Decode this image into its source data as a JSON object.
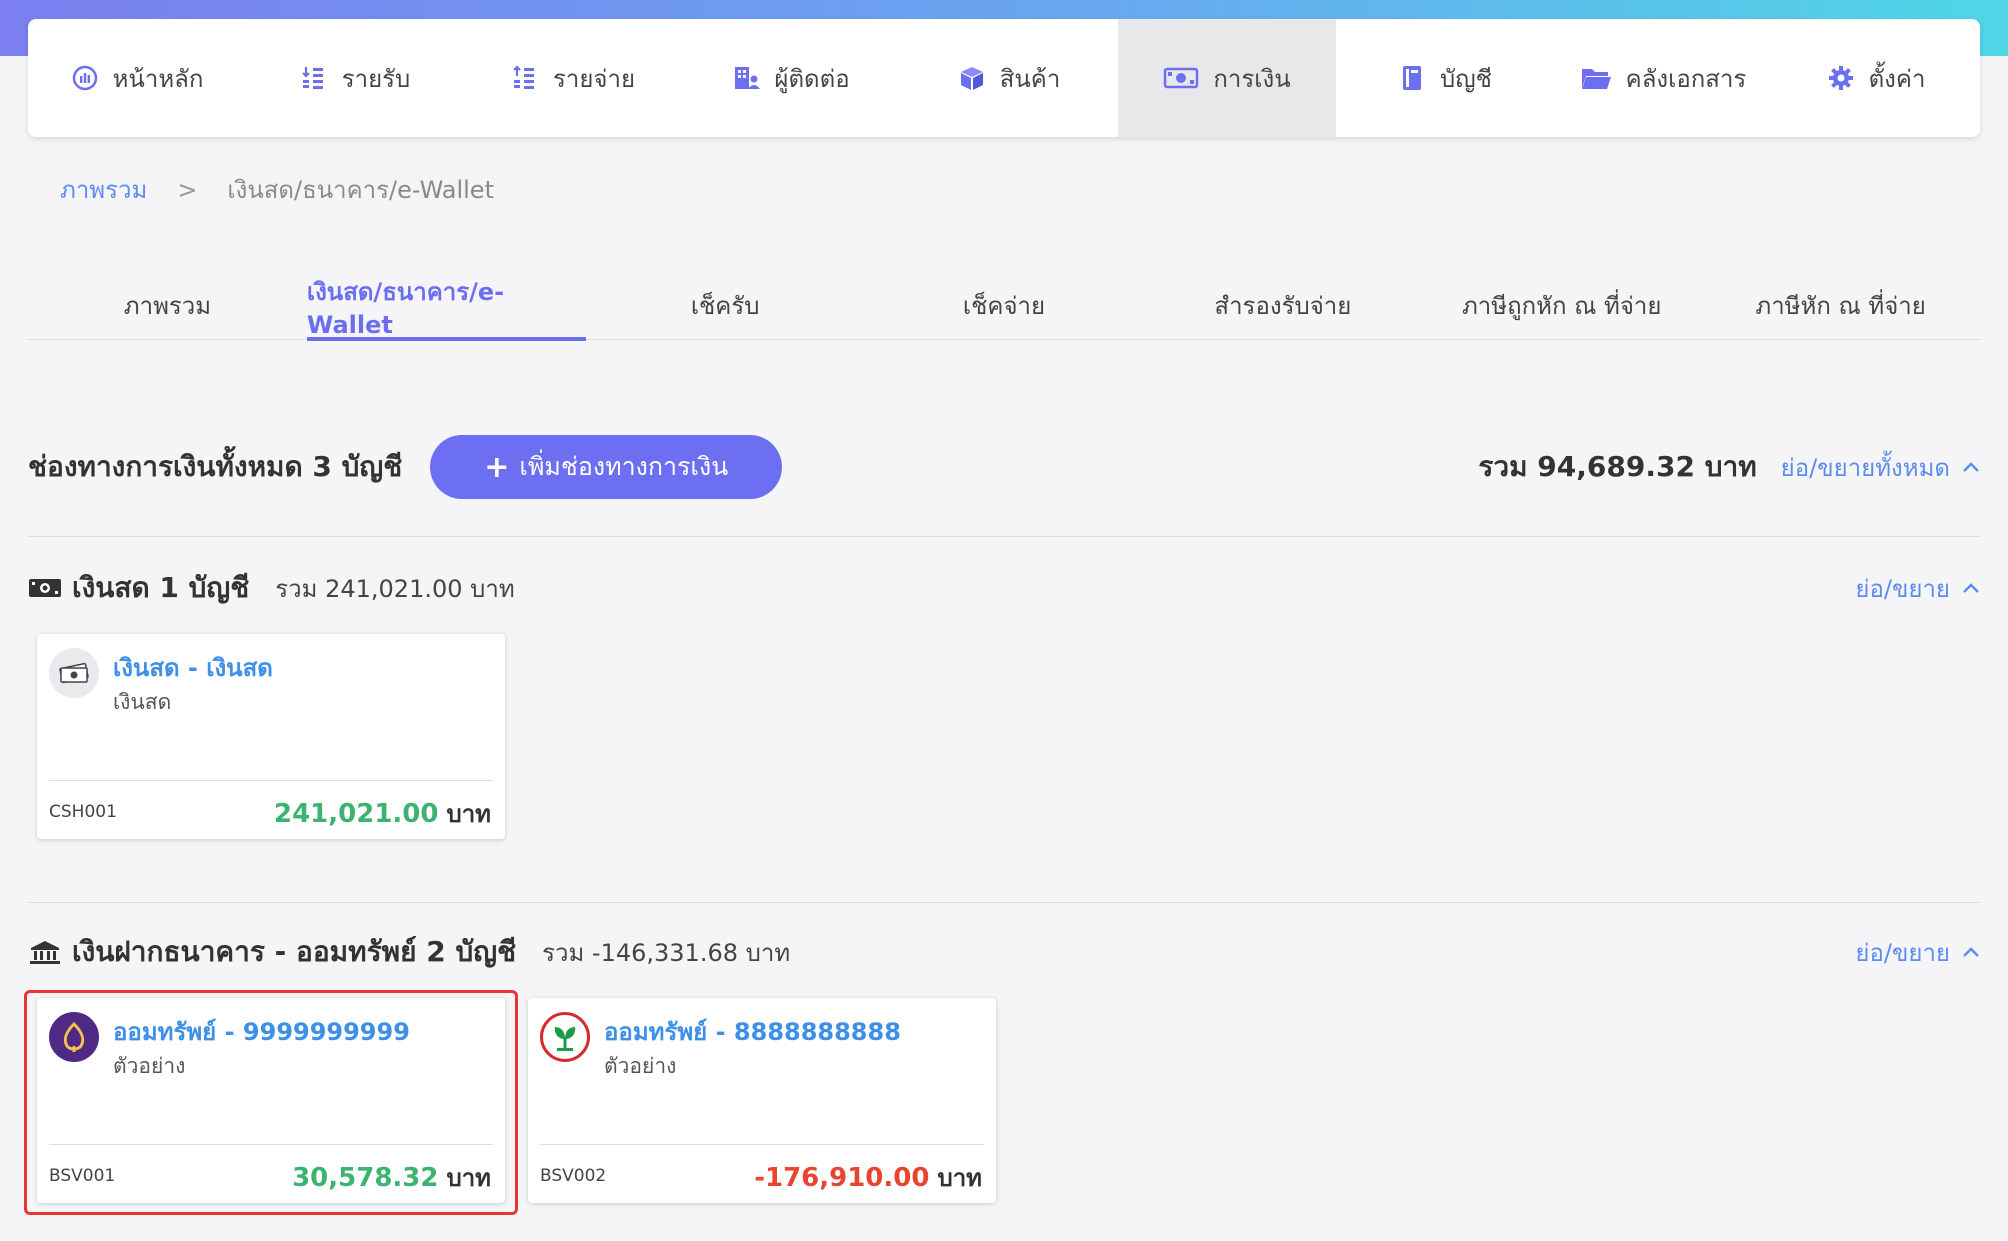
{
  "nav": {
    "items": [
      {
        "label": "หน้าหลัก",
        "icon": "dashboard-icon",
        "active": false
      },
      {
        "label": "รายรับ",
        "icon": "income-list-icon",
        "active": false
      },
      {
        "label": "รายจ่าย",
        "icon": "expense-list-icon",
        "active": false
      },
      {
        "label": "ผู้ติดต่อ",
        "icon": "contacts-building-icon",
        "active": false
      },
      {
        "label": "สินค้า",
        "icon": "product-box-icon",
        "active": false
      },
      {
        "label": "การเงิน",
        "icon": "money-icon",
        "active": true
      },
      {
        "label": "บัญชี",
        "icon": "ledger-book-icon",
        "active": false
      },
      {
        "label": "คลังเอกสาร",
        "icon": "folder-icon",
        "active": false
      },
      {
        "label": "ตั้งค่า",
        "icon": "gear-icon",
        "active": false
      }
    ]
  },
  "breadcrumb": {
    "root": "ภาพรวม",
    "separator": ">",
    "current": "เงินสด/ธนาคาร/e-Wallet"
  },
  "subtabs": [
    {
      "label": "ภาพรวม",
      "active": false
    },
    {
      "label": "เงินสด/ธนาคาร/e-Wallet",
      "active": true
    },
    {
      "label": "เช็ครับ",
      "active": false
    },
    {
      "label": "เช็คจ่าย",
      "active": false
    },
    {
      "label": "สำรองรับจ่าย",
      "active": false
    },
    {
      "label": "ภาษีถูกหัก ณ ที่จ่าย",
      "active": false
    },
    {
      "label": "ภาษีหัก ณ ที่จ่าย",
      "active": false
    }
  ],
  "summary": {
    "title": "ช่องทางการเงินทั้งหมด 3 บัญชี",
    "add_button": "เพิ่มช่องทางการเงิน",
    "add_icon": "+",
    "total": "รวม 94,689.32 บาท",
    "toggle_all": "ย่อ/ขยายทั้งหมด"
  },
  "sections": {
    "cash": {
      "title": "เงินสด 1 บัญชี",
      "sum": "รวม 241,021.00 บาท",
      "toggle": "ย่อ/ขยาย",
      "icon": "cash-icon",
      "cards": [
        {
          "title": "เงินสด - เงินสด",
          "subtitle": "เงินสด",
          "code": "CSH001",
          "amount": "241,021.00",
          "unit": "บาท",
          "avatar": "cash-avatar-icon"
        }
      ]
    },
    "bank": {
      "title": "เงินฝากธนาคาร - ออมทรัพย์ 2 บัญชี",
      "sum": "รวม -146,331.68 บาท",
      "toggle": "ย่อ/ขยาย",
      "icon": "bank-icon",
      "cards": [
        {
          "title": "ออมทรัพย์ - 9999999999",
          "subtitle": "ตัวอย่าง",
          "code": "BSV001",
          "amount": "30,578.32",
          "unit": "บาท",
          "avatar": "scb-bank-logo-icon",
          "selected": true
        },
        {
          "title": "ออมทรัพย์ - 8888888888",
          "subtitle": "ตัวอย่าง",
          "code": "BSV002",
          "amount": "-176,910.00",
          "unit": "บาท",
          "avatar": "kbank-logo-icon",
          "selected": false
        }
      ]
    }
  },
  "colors": {
    "accent": "#6d6ff2",
    "link": "#5b8def",
    "positive": "#3cb371",
    "negative": "#e8452f",
    "highlight": "#e8352f"
  }
}
